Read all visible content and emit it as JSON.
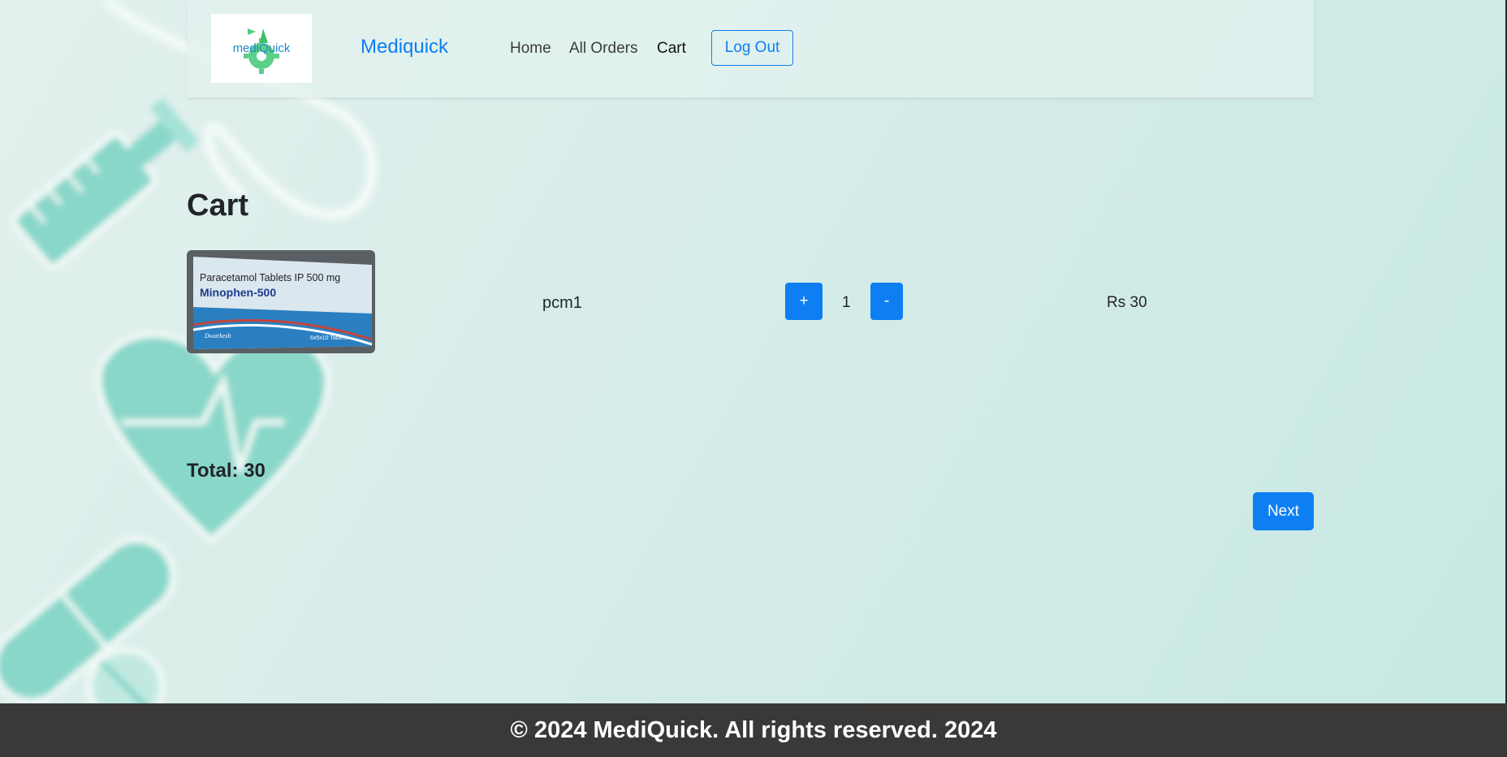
{
  "app": {
    "logo_text": "mediQuick",
    "brand": "Mediquick",
    "accent": "#0d7ff2"
  },
  "nav": {
    "items": [
      {
        "label": "Home"
      },
      {
        "label": "All Orders"
      },
      {
        "label": "Cart"
      }
    ],
    "logout_label": "Log Out"
  },
  "page": {
    "title": "Cart"
  },
  "cart": {
    "items": [
      {
        "image_text_line1": "Paracetamol Tablets IP 500 mg",
        "image_text_line2": "Minophen-500",
        "image_text_line3": "6x5x10 Tablets",
        "image_text_brand": "Dwarkesh",
        "name": "pcm1",
        "plus_label": "+",
        "quantity": "1",
        "minus_label": "-",
        "price": "Rs 30"
      }
    ],
    "total_label": "Total: 30",
    "next_label": "Next"
  },
  "footer": {
    "text": "© 2024 MediQuick. All rights reserved. 2024"
  }
}
